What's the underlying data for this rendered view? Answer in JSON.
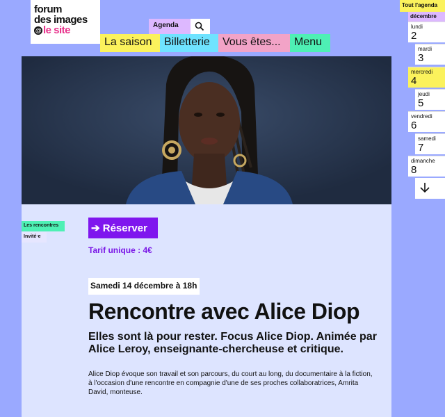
{
  "logo": {
    "line1": "forum",
    "line2": "des images",
    "line3": "le site",
    "at_symbol": "@"
  },
  "header": {
    "agenda_label": "Agenda",
    "search_icon": "search-icon",
    "nav": [
      {
        "label": "La saison",
        "color": "#fbf25c"
      },
      {
        "label": "Billetterie",
        "color": "#6fe3ff"
      },
      {
        "label": "Vous êtes...",
        "color": "#f2a3c7"
      },
      {
        "label": "Menu",
        "color": "#4ef0b4"
      }
    ]
  },
  "event": {
    "tags": [
      "Les rencontres",
      "Invité·e"
    ],
    "reserve_label": "➔ Réserver",
    "tarif": "Tarif unique : 4€",
    "date": "Samedi 14 décembre à 18h",
    "title": "Rencontre avec Alice Diop",
    "subtitle": "Elles sont là pour rester. Focus Alice Diop. Animée par Alice Leroy, enseignante-chercheuse et critique.",
    "description": "Alice Diop évoque son travail et son parcours, du court au long, du documentaire à la fiction, à l'occasion d'une rencontre en compagnie d'une de ses proches collaboratrices, Amrita David, monteuse."
  },
  "agenda_sidebar": {
    "all_label": "Tout l'agenda",
    "month": "décembre",
    "days": [
      {
        "name": "lundi",
        "num": "2"
      },
      {
        "name": "mardi",
        "num": "3"
      },
      {
        "name": "mercredi",
        "num": "4",
        "selected": true
      },
      {
        "name": "jeudi",
        "num": "5"
      },
      {
        "name": "vendredi",
        "num": "6"
      },
      {
        "name": "samedi",
        "num": "7"
      },
      {
        "name": "dimanche",
        "num": "8"
      }
    ],
    "down_icon": "arrow-down-icon"
  },
  "colors": {
    "background": "#9aa9ff",
    "content_bg": "#dde4ff",
    "accent_purple": "#7f16ee",
    "yellow": "#fbf25c",
    "green": "#4ef0b4",
    "pink": "#e8328c"
  }
}
